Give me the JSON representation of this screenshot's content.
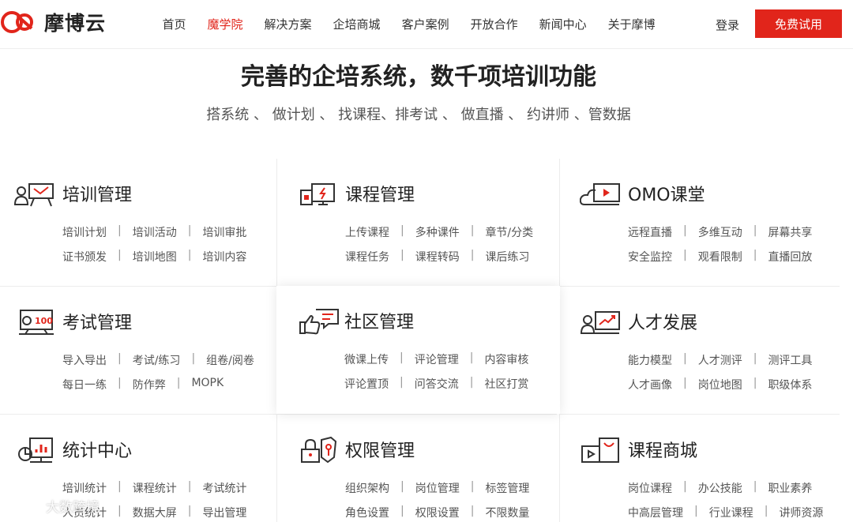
{
  "header": {
    "logo_text": "摩博云",
    "nav": [
      "首页",
      "魔学院",
      "解决方案",
      "企培商城",
      "客户案例",
      "开放合作",
      "新闻中心",
      "关于摩博"
    ],
    "active_index": 1,
    "login": "登录",
    "trial": "免费试用"
  },
  "hero": {
    "title": "完善的企培系统，数千项培训功能",
    "subtitle": "搭系统 、 做计划 、 找课程、排考试 、 做直播 、 约讲师 、管数据"
  },
  "features": [
    {
      "title": "培训管理",
      "icon": "trainer-board-icon",
      "row1": [
        "培训计划",
        "培训活动",
        "培训审批"
      ],
      "row2": [
        "证书颁发",
        "培训地图",
        "培训内容"
      ]
    },
    {
      "title": "课程管理",
      "icon": "course-screen-icon",
      "row1": [
        "上传课程",
        "多种课件",
        "章节/分类"
      ],
      "row2": [
        "课程任务",
        "课程转码",
        "课后练习"
      ]
    },
    {
      "title": "OMO课堂",
      "icon": "cloud-video-icon",
      "row1": [
        "远程直播",
        "多维互动",
        "屏幕共享"
      ],
      "row2": [
        "安全监控",
        "观看限制",
        "直播回放"
      ]
    },
    {
      "title": "考试管理",
      "icon": "exam-score-icon",
      "row1": [
        "导入导出",
        "考试/练习",
        "组卷/阅卷"
      ],
      "row2": [
        "每日一练",
        "防作弊",
        "MOPK"
      ]
    },
    {
      "title": "社区管理",
      "icon": "community-chat-icon",
      "row1": [
        "微课上传",
        "评论管理",
        "内容审核"
      ],
      "row2": [
        "评论置顶",
        "问答交流",
        "社区打赏"
      ]
    },
    {
      "title": "人才发展",
      "icon": "growth-chart-icon",
      "row1": [
        "能力模型",
        "人才测评",
        "测评工具"
      ],
      "row2": [
        "人才画像",
        "岗位地图",
        "职级体系"
      ]
    },
    {
      "title": "统计中心",
      "icon": "statistics-icon",
      "row1": [
        "培训统计",
        "课程统计",
        "考试统计"
      ],
      "row2": [
        "人员统计",
        "数据大屏",
        "导出管理"
      ]
    },
    {
      "title": "权限管理",
      "icon": "lock-shield-icon",
      "row1": [
        "组织架构",
        "岗位管理",
        "标签管理"
      ],
      "row2": [
        "角色设置",
        "权限设置",
        "不限数量"
      ]
    },
    {
      "title": "课程商城",
      "icon": "video-store-icon",
      "row1": [
        "岗位课程",
        "办公技能",
        "职业素养"
      ],
      "row2": [
        "中高层管理",
        "行业课程",
        "讲师资源"
      ]
    }
  ],
  "watermark": "大数跨境",
  "colors": {
    "brand": "#e1251b",
    "text": "#333333"
  }
}
